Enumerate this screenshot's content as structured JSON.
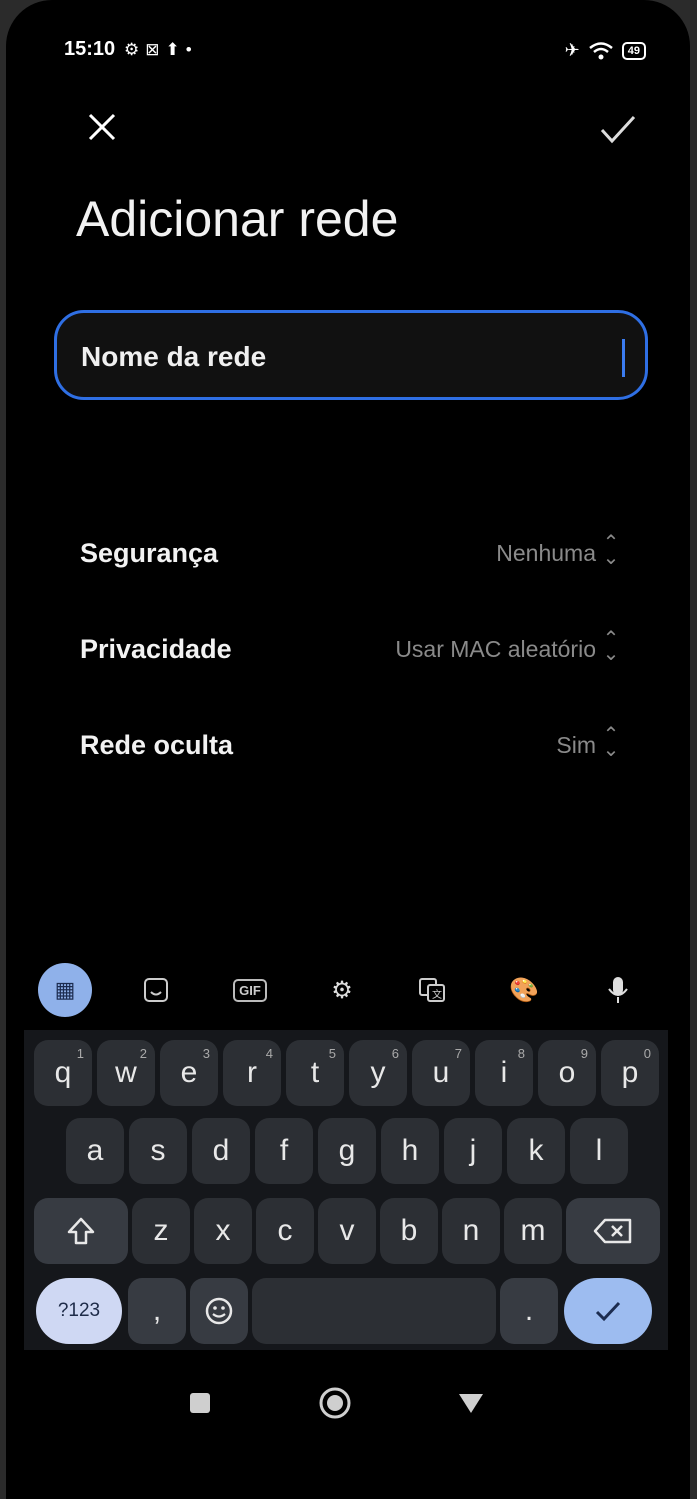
{
  "status_bar": {
    "time": "15:10",
    "left_icons": [
      "gear-icon",
      "notification-icon",
      "upload-icon",
      "dot-icon"
    ],
    "battery": "49"
  },
  "header": {
    "title": "Adicionar rede",
    "close_icon": "close-icon",
    "confirm_icon": "check-icon"
  },
  "network_name": {
    "placeholder": "Nome da rede",
    "value": ""
  },
  "settings": [
    {
      "label": "Segurança",
      "value": "Nenhuma"
    },
    {
      "label": "Privacidade",
      "value": "Usar MAC aleatório"
    },
    {
      "label": "Rede oculta",
      "value": "Sim"
    }
  ],
  "keyboard_toolbar": [
    "grid-icon",
    "sticker-icon",
    "gif-icon",
    "settings-icon",
    "translate-icon",
    "palette-icon",
    "mic-icon"
  ],
  "gif_label": "GIF",
  "keyboard": {
    "row1": [
      {
        "k": "q",
        "n": "1"
      },
      {
        "k": "w",
        "n": "2"
      },
      {
        "k": "e",
        "n": "3"
      },
      {
        "k": "r",
        "n": "4"
      },
      {
        "k": "t",
        "n": "5"
      },
      {
        "k": "y",
        "n": "6"
      },
      {
        "k": "u",
        "n": "7"
      },
      {
        "k": "i",
        "n": "8"
      },
      {
        "k": "o",
        "n": "9"
      },
      {
        "k": "p",
        "n": "0"
      }
    ],
    "row2": [
      "a",
      "s",
      "d",
      "f",
      "g",
      "h",
      "j",
      "k",
      "l"
    ],
    "row3": [
      "z",
      "x",
      "c",
      "v",
      "b",
      "n",
      "m"
    ],
    "num_label": "?123",
    "comma": ",",
    "period": "."
  },
  "nav_bar": [
    "recents-icon",
    "home-icon",
    "back-icon"
  ]
}
